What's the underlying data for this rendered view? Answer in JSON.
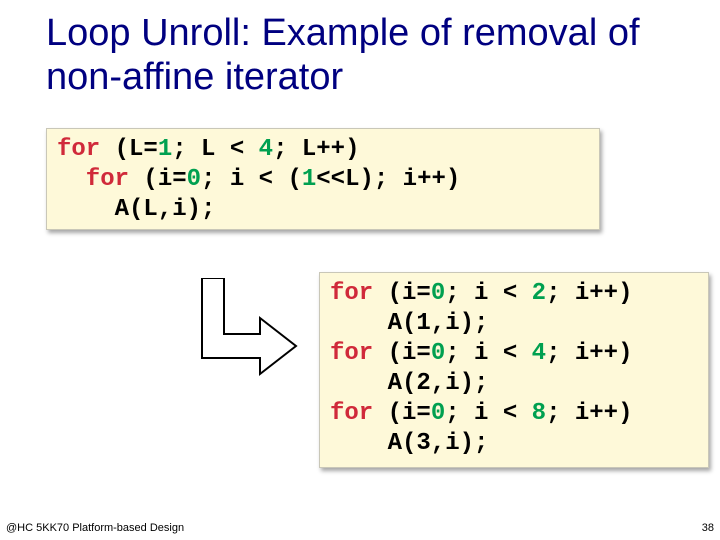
{
  "title": "Loop Unroll: Example of removal of non-affine iterator",
  "code1": {
    "l1_a": "for",
    "l1_b": " (L=",
    "l1_c": "1",
    "l1_d": "; L < ",
    "l1_e": "4",
    "l1_f": "; L++)",
    "l2_a": "  for",
    "l2_b": " (i=",
    "l2_c": "0",
    "l2_d": "; i < (",
    "l2_e": "1",
    "l2_f": "<<L); i++)",
    "l3": "    A(L,i);"
  },
  "code2": {
    "l1_a": "for",
    "l1_b": " (i=",
    "l1_c": "0",
    "l1_d": "; i < ",
    "l1_e": "2",
    "l1_f": "; i++)",
    "l2": "    A(1,i);",
    "l3_a": "for",
    "l3_b": " (i=",
    "l3_c": "0",
    "l3_d": "; i < ",
    "l3_e": "4",
    "l3_f": "; i++)",
    "l4": "    A(2,i);",
    "l5_a": "for",
    "l5_b": " (i=",
    "l5_c": "0",
    "l5_d": "; i < ",
    "l5_e": "8",
    "l5_f": "; i++)",
    "l6": "    A(3,i);"
  },
  "footer": {
    "left": "@HC 5KK70 Platform-based Design",
    "right": "38"
  }
}
